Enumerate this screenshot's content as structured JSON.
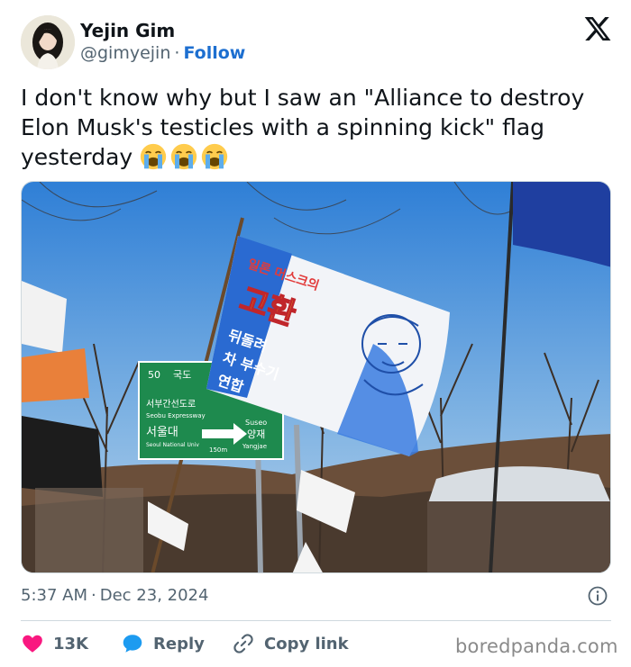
{
  "author": {
    "name": "Yejin Gim",
    "handle": "@gimyejin",
    "separator": "·",
    "follow_label": "Follow"
  },
  "tweet": {
    "text": "I don't know why but I saw an \"Alliance to destroy Elon Musk's testicles with a spinning kick\" flag yesterday",
    "emojis": [
      "loudly-crying-face-icon",
      "loudly-crying-face-icon",
      "loudly-crying-face-icon"
    ]
  },
  "media": {
    "flag_text_line1": "일론 머스크의",
    "flag_text_line2": "고환",
    "flag_text_line3": "뒤돌려",
    "flag_text_line4": "차 부수기",
    "flag_text_line5": "연합",
    "sign_top": "국도",
    "sign_line1": "서부간선도로",
    "sign_line2": "Seobu Expressway",
    "sign_line3": "서울대",
    "sign_line4": "Seoul National Univ",
    "sign_right1": "Suseo",
    "sign_right2": "양재",
    "sign_right3": "Yangjae",
    "sign_distance": "150m",
    "sign_route": "50"
  },
  "meta": {
    "time": "5:37 AM",
    "separator": "·",
    "date": "Dec 23, 2024"
  },
  "actions": {
    "like_count": "13K",
    "reply_label": "Reply",
    "copy_label": "Copy link"
  },
  "watermark": "boredpanda.com",
  "colors": {
    "follow_blue": "#1d6fd0",
    "like_pink": "#f91880",
    "reply_blue": "#1d9bf0",
    "muted": "#536471",
    "text": "#0f1419"
  }
}
